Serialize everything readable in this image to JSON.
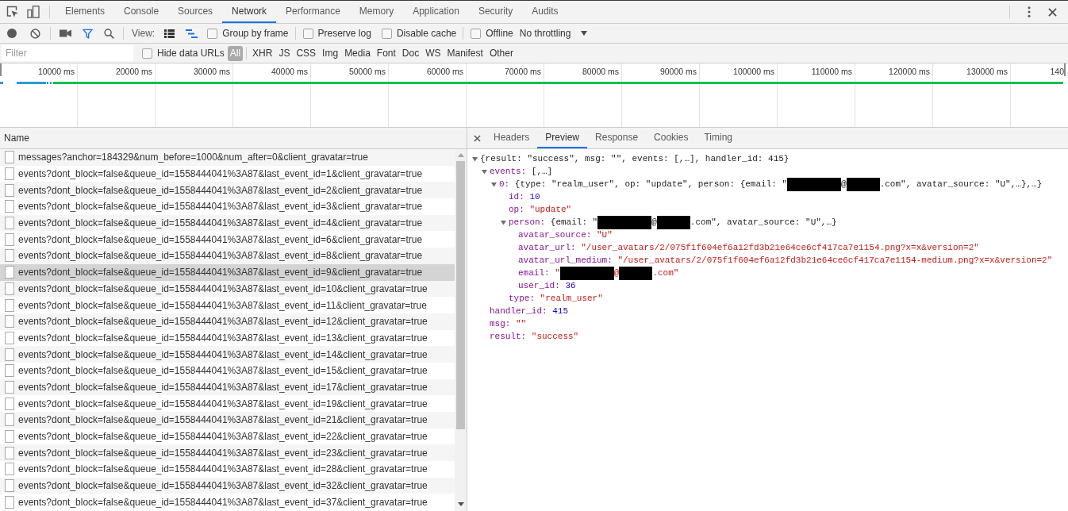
{
  "devtools": {
    "tabs": [
      {
        "label": "Elements",
        "selected": false
      },
      {
        "label": "Console",
        "selected": false
      },
      {
        "label": "Sources",
        "selected": false
      },
      {
        "label": "Network",
        "selected": true
      },
      {
        "label": "Performance",
        "selected": false
      },
      {
        "label": "Memory",
        "selected": false
      },
      {
        "label": "Application",
        "selected": false
      },
      {
        "label": "Security",
        "selected": false
      },
      {
        "label": "Audits",
        "selected": false
      }
    ]
  },
  "network_toolbar": {
    "recording": false,
    "capture_screenshots": false,
    "filter_shown": true,
    "view_label": "View:",
    "large_rows": false,
    "overview": true,
    "option_groups": [
      [
        {
          "label": "Group by frame",
          "checked": false
        }
      ],
      [
        {
          "label": "Preserve log",
          "checked": false
        },
        {
          "label": "Disable cache",
          "checked": false
        }
      ],
      [
        {
          "label": "Offline",
          "checked": false
        }
      ]
    ],
    "throttling": "No throttling"
  },
  "filter_bar": {
    "filter": {
      "placeholder": "Filter"
    },
    "hide_data_urls": {
      "label": "Hide data URLs",
      "checked": false
    },
    "types": [
      {
        "label": "All",
        "selected": true
      },
      {
        "label": "XHR",
        "selected": false
      },
      {
        "label": "JS",
        "selected": false
      },
      {
        "label": "CSS",
        "selected": false
      },
      {
        "label": "Img",
        "selected": false
      },
      {
        "label": "Media",
        "selected": false
      },
      {
        "label": "Font",
        "selected": false
      },
      {
        "label": "Doc",
        "selected": false
      },
      {
        "label": "WS",
        "selected": false
      },
      {
        "label": "Manifest",
        "selected": false
      },
      {
        "label": "Other",
        "selected": false
      }
    ]
  },
  "timeline": {
    "ticks": [
      "10000 ms",
      "20000 ms",
      "30000 ms",
      "40000 ms",
      "50000 ms",
      "60000 ms",
      "70000 ms",
      "80000 ms",
      "90000 ms",
      "100000 ms",
      "110000 ms",
      "120000 ms",
      "130000 ms",
      "140"
    ]
  },
  "requests": {
    "column": "Name",
    "rows": [
      {
        "name": "messages?anchor=184329&num_before=1000&num_after=0&client_gravatar=true",
        "selected": false
      },
      {
        "name": "events?dont_block=false&queue_id=1558444041%3A87&last_event_id=1&client_gravatar=true",
        "selected": false
      },
      {
        "name": "events?dont_block=false&queue_id=1558444041%3A87&last_event_id=2&client_gravatar=true",
        "selected": false
      },
      {
        "name": "events?dont_block=false&queue_id=1558444041%3A87&last_event_id=3&client_gravatar=true",
        "selected": false
      },
      {
        "name": "events?dont_block=false&queue_id=1558444041%3A87&last_event_id=4&client_gravatar=true",
        "selected": false
      },
      {
        "name": "events?dont_block=false&queue_id=1558444041%3A87&last_event_id=6&client_gravatar=true",
        "selected": false
      },
      {
        "name": "events?dont_block=false&queue_id=1558444041%3A87&last_event_id=8&client_gravatar=true",
        "selected": false
      },
      {
        "name": "events?dont_block=false&queue_id=1558444041%3A87&last_event_id=9&client_gravatar=true",
        "selected": true
      },
      {
        "name": "events?dont_block=false&queue_id=1558444041%3A87&last_event_id=10&client_gravatar=true",
        "selected": false
      },
      {
        "name": "events?dont_block=false&queue_id=1558444041%3A87&last_event_id=11&client_gravatar=true",
        "selected": false
      },
      {
        "name": "events?dont_block=false&queue_id=1558444041%3A87&last_event_id=12&client_gravatar=true",
        "selected": false
      },
      {
        "name": "events?dont_block=false&queue_id=1558444041%3A87&last_event_id=13&client_gravatar=true",
        "selected": false
      },
      {
        "name": "events?dont_block=false&queue_id=1558444041%3A87&last_event_id=14&client_gravatar=true",
        "selected": false
      },
      {
        "name": "events?dont_block=false&queue_id=1558444041%3A87&last_event_id=15&client_gravatar=true",
        "selected": false
      },
      {
        "name": "events?dont_block=false&queue_id=1558444041%3A87&last_event_id=17&client_gravatar=true",
        "selected": false
      },
      {
        "name": "events?dont_block=false&queue_id=1558444041%3A87&last_event_id=19&client_gravatar=true",
        "selected": false
      },
      {
        "name": "events?dont_block=false&queue_id=1558444041%3A87&last_event_id=21&client_gravatar=true",
        "selected": false
      },
      {
        "name": "events?dont_block=false&queue_id=1558444041%3A87&last_event_id=22&client_gravatar=true",
        "selected": false
      },
      {
        "name": "events?dont_block=false&queue_id=1558444041%3A87&last_event_id=23&client_gravatar=true",
        "selected": false
      },
      {
        "name": "events?dont_block=false&queue_id=1558444041%3A87&last_event_id=28&client_gravatar=true",
        "selected": false
      },
      {
        "name": "events?dont_block=false&queue_id=1558444041%3A87&last_event_id=32&client_gravatar=true",
        "selected": false
      },
      {
        "name": "events?dont_block=false&queue_id=1558444041%3A87&last_event_id=37&client_gravatar=true",
        "selected": false
      }
    ]
  },
  "preview": {
    "tabs": [
      {
        "label": "Headers",
        "selected": false
      },
      {
        "label": "Preview",
        "selected": true
      },
      {
        "label": "Response",
        "selected": false
      },
      {
        "label": "Cookies",
        "selected": false
      },
      {
        "label": "Timing",
        "selected": false
      }
    ],
    "tree": {
      "kind": "preview",
      "parts": [
        {
          "kind": "text",
          "text": "{result: \"success\", msg: \"\", events: [,…], handler_id: 415}"
        }
      ],
      "expanded": true,
      "children": [
        {
          "key": "events:",
          "kind": "preview",
          "parts": [
            {
              "kind": "text",
              "text": "[,…]"
            }
          ],
          "expanded": true,
          "children": [
            {
              "key": "0:",
              "kind": "preview",
              "parts": [
                {
                  "kind": "text",
                  "text": "{type: \"realm_user\", op: \"update\", person: {email: \""
                },
                {
                  "kind": "redacted"
                },
                {
                  "kind": "text",
                  "text": "@"
                },
                {
                  "kind": "redacted"
                },
                {
                  "kind": "text",
                  "text": ".com\", avatar_source: \"U\",…},…}"
                }
              ],
              "expanded": true,
              "children": [
                {
                  "key": "id:",
                  "kind": "number",
                  "parts": [
                    {
                      "kind": "text",
                      "text": "10"
                    }
                  ]
                },
                {
                  "key": "op:",
                  "kind": "string",
                  "parts": [
                    {
                      "kind": "text",
                      "text": "\"update\""
                    }
                  ]
                },
                {
                  "key": "person:",
                  "kind": "preview",
                  "parts": [
                    {
                      "kind": "text",
                      "text": "{email: \""
                    },
                    {
                      "kind": "redacted"
                    },
                    {
                      "kind": "text",
                      "text": "@"
                    },
                    {
                      "kind": "redacted"
                    },
                    {
                      "kind": "text",
                      "text": ".com\", avatar_source: \"U\",…}"
                    }
                  ],
                  "expanded": true,
                  "children": [
                    {
                      "key": "avatar_source:",
                      "kind": "string",
                      "parts": [
                        {
                          "kind": "text",
                          "text": "\"U\""
                        }
                      ]
                    },
                    {
                      "key": "avatar_url:",
                      "kind": "string",
                      "parts": [
                        {
                          "kind": "text",
                          "text": "\"/user_avatars/2/075f1f604ef6a12fd3b21e64ce6cf417ca7e1154.png?x=x&version=2\""
                        }
                      ]
                    },
                    {
                      "key": "avatar_url_medium:",
                      "kind": "string",
                      "parts": [
                        {
                          "kind": "text",
                          "text": "\"/user_avatars/2/075f1f604ef6a12fd3b21e64ce6cf417ca7e1154-medium.png?x=x&version=2\""
                        }
                      ]
                    },
                    {
                      "key": "email:",
                      "kind": "string",
                      "parts": [
                        {
                          "kind": "text",
                          "text": "\""
                        },
                        {
                          "kind": "redacted"
                        },
                        {
                          "kind": "text",
                          "text": "@"
                        },
                        {
                          "kind": "redacted"
                        },
                        {
                          "kind": "text",
                          "text": ".com\""
                        }
                      ]
                    },
                    {
                      "key": "user_id:",
                      "kind": "number",
                      "parts": [
                        {
                          "kind": "text",
                          "text": "36"
                        }
                      ]
                    }
                  ]
                },
                {
                  "key": "type:",
                  "kind": "string",
                  "parts": [
                    {
                      "kind": "text",
                      "text": "\"realm_user\""
                    }
                  ]
                }
              ]
            }
          ]
        },
        {
          "key": "handler_id:",
          "kind": "number",
          "parts": [
            {
              "kind": "text",
              "text": "415"
            }
          ]
        },
        {
          "key": "msg:",
          "kind": "string",
          "parts": [
            {
              "kind": "text",
              "text": "\"\""
            }
          ]
        },
        {
          "key": "result:",
          "kind": "string",
          "parts": [
            {
              "kind": "text",
              "text": "\"success\""
            }
          ]
        }
      ]
    }
  }
}
